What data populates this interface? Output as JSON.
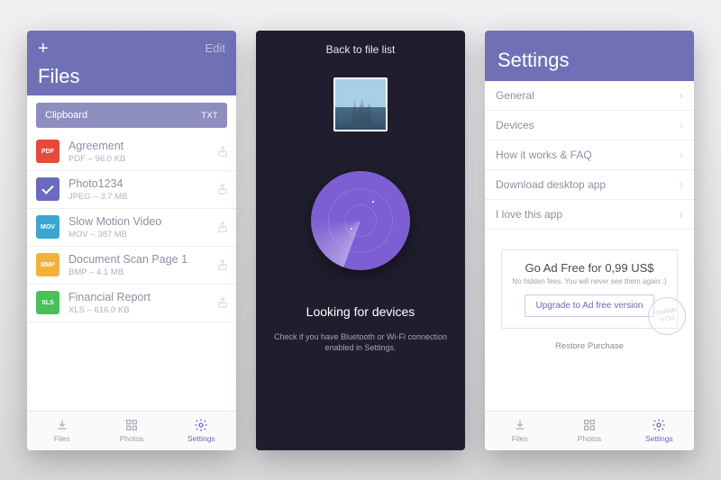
{
  "colors": {
    "accent": "#7070b7",
    "radar": "#7d5fd3"
  },
  "screen1": {
    "edit_label": "Edit",
    "title": "Files",
    "clipboard": {
      "label": "Clipboard",
      "ext": "TXT"
    },
    "files": [
      {
        "badge": "PDF",
        "badge_color": "#e64a3b",
        "name": "Agreement",
        "meta": "PDF – 96.0 KB"
      },
      {
        "badge": "",
        "badge_color": "#6a6ac0",
        "name": "Photo1234",
        "meta": "JPEG – 3.7 MB",
        "selected": true
      },
      {
        "badge": "MOV",
        "badge_color": "#3aa6cf",
        "name": "Slow Motion Video",
        "meta": "MOV – 387 MB"
      },
      {
        "badge": "BMP",
        "badge_color": "#f2b23a",
        "name": "Document Scan Page 1",
        "meta": "BMP – 4.1 MB"
      },
      {
        "badge": "XLS",
        "badge_color": "#4bbf5a",
        "name": "Financial Report",
        "meta": "XLS – 616.0 KB"
      }
    ],
    "tabs": [
      {
        "label": "Files",
        "active": false
      },
      {
        "label": "Photos",
        "active": false
      },
      {
        "label": "Settings",
        "active": true
      }
    ]
  },
  "screen2": {
    "back_label": "Back to file list",
    "status": "Looking for devices",
    "hint": "Check if you have Bluetooth or Wi-Fi connection enabled in Settings."
  },
  "screen3": {
    "title": "Settings",
    "items": [
      "General",
      "Devices",
      "How it works & FAQ",
      "Download desktop app",
      "I love this app"
    ],
    "promo": {
      "headline": "Go Ad Free for 0,99 US$",
      "sub": "No hidden fees. You will never see them again :)",
      "cta": "Upgrade to Ad free version",
      "stamp": "THANK YOU"
    },
    "restore": "Restore Purchase",
    "tabs": [
      {
        "label": "Files",
        "active": false
      },
      {
        "label": "Photos",
        "active": false
      },
      {
        "label": "Settings",
        "active": true
      }
    ]
  }
}
